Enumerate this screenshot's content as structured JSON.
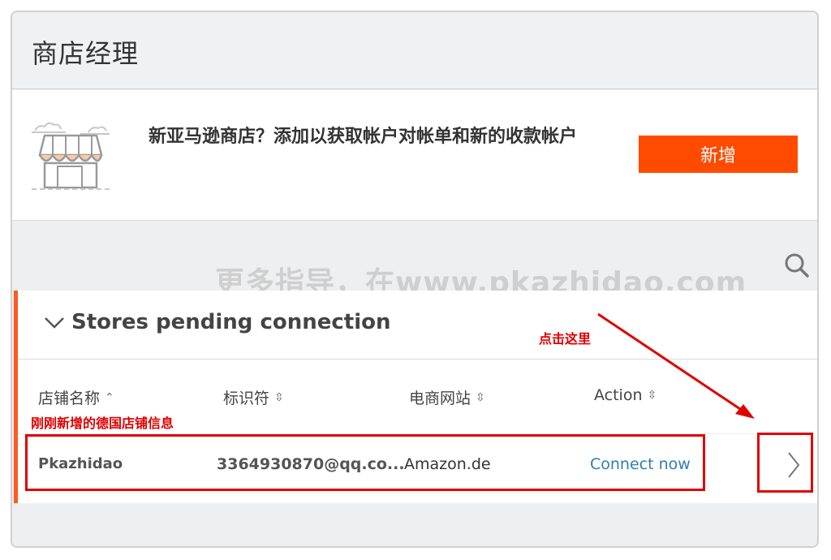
{
  "header": {
    "title": "商店经理"
  },
  "promo": {
    "text": "新亚马逊商店？添加以获取帐户对帐单和新的收款帐户",
    "add_button": "新增"
  },
  "watermark": "更多指导，在www.pkazhidao.com",
  "section": {
    "title": "Stores pending connection",
    "columns": [
      {
        "label": "店铺名称",
        "sort": "⌃"
      },
      {
        "label": "标识符",
        "sort": "⇳"
      },
      {
        "label": "电商网站",
        "sort": "⇳"
      },
      {
        "label": "Action",
        "sort": "⇳"
      }
    ],
    "rows": [
      {
        "store_name": "Pkazhidao",
        "identifier": "3364930870@qq.co...",
        "marketplace": "Amazon.de",
        "action": "Connect now"
      }
    ]
  },
  "annotations": {
    "click_here": "点击这里",
    "new_store_info": "刚刚新增的德国店铺信息"
  },
  "colors": {
    "accent": "#ff4b00",
    "link": "#2f7fb0",
    "annotation": "#e00000"
  }
}
